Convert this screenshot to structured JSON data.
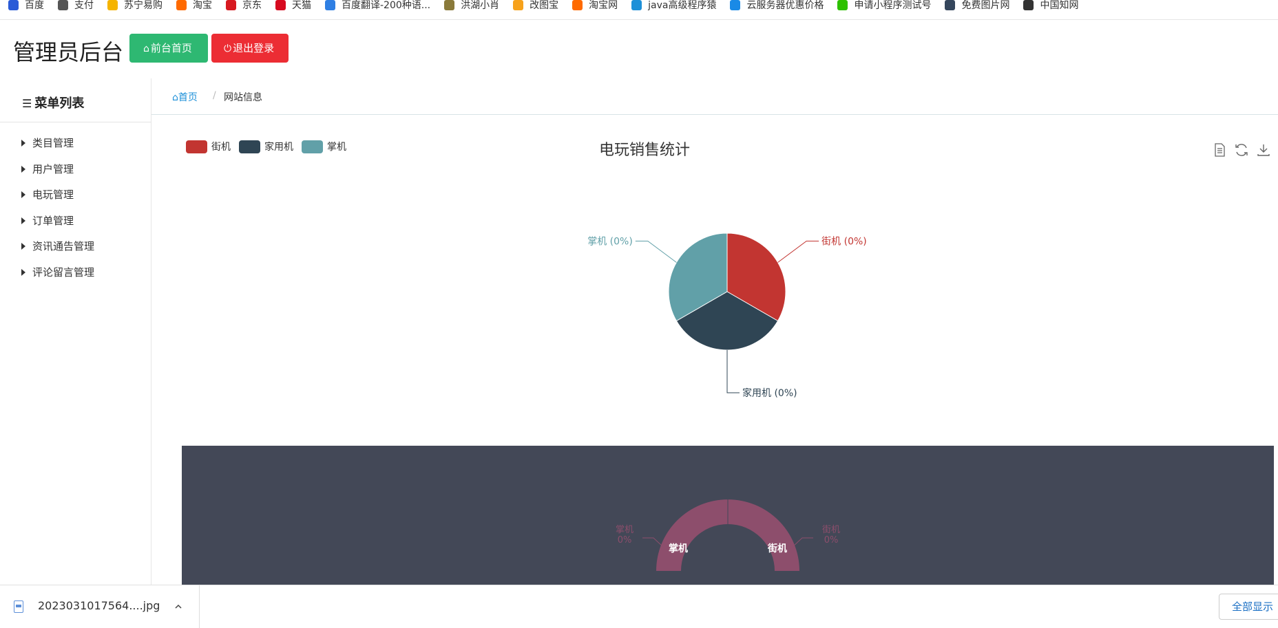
{
  "bookmarks": [
    {
      "label": "百度",
      "icon": "baidu-icon",
      "color": "#2a5bd7"
    },
    {
      "label": "支付",
      "icon": "globe-icon",
      "color": "#555555"
    },
    {
      "label": "苏宁易购",
      "icon": "suning-icon",
      "color": "#f5b400"
    },
    {
      "label": "淘宝",
      "icon": "taobao-icon",
      "color": "#ff6a00"
    },
    {
      "label": "京东",
      "icon": "jd-icon",
      "color": "#d71920"
    },
    {
      "label": "天猫",
      "icon": "tmall-icon",
      "color": "#d70a1f"
    },
    {
      "label": "百度翻译-200种语...",
      "icon": "translate-icon",
      "color": "#2f7fe3"
    },
    {
      "label": "洪湖小肖",
      "icon": "bird-icon",
      "color": "#8a7a3a"
    },
    {
      "label": "改图宝",
      "icon": "gaitubao-icon",
      "color": "#f7a21b"
    },
    {
      "label": "淘宝网",
      "icon": "taobao-net-icon",
      "color": "#ff6a00"
    },
    {
      "label": "java高级程序猿",
      "icon": "bilibili-icon",
      "color": "#1e90d8"
    },
    {
      "label": "云服务器优惠价格",
      "icon": "cloud-icon",
      "color": "#1a8ae6"
    },
    {
      "label": "申请小程序测试号",
      "icon": "wechat-icon",
      "color": "#2dc100"
    },
    {
      "label": "免费图片网",
      "icon": "tumblr-icon",
      "color": "#35465c"
    },
    {
      "label": "中国知网",
      "icon": "cnki-icon",
      "color": "#333333"
    }
  ],
  "header": {
    "title": "管理员后台",
    "home_button": "前台首页",
    "logout_button": "退出登录"
  },
  "sidebar": {
    "title": "菜单列表",
    "items": [
      "类目管理",
      "用户管理",
      "电玩管理",
      "订单管理",
      "资讯通告管理",
      "评论留言管理"
    ]
  },
  "breadcrumb": {
    "home": "首页",
    "current": "网站信息"
  },
  "colors": {
    "arcade": "#c23531",
    "console": "#2f4554",
    "handheld": "#61a0a8",
    "dark_bg": "#434857",
    "rose": "#8d4e6c"
  },
  "chart_data": [
    {
      "type": "pie",
      "title": "电玩销售统计",
      "legend": [
        "街机",
        "家用机",
        "掌机"
      ],
      "legend_position": "top-left",
      "slices": [
        {
          "name": "街机",
          "value": 1,
          "label": "街机 (0%)"
        },
        {
          "name": "家用机",
          "value": 1,
          "label": "家用机 (0%)"
        },
        {
          "name": "掌机",
          "value": 1,
          "label": "掌机 (0%)"
        }
      ]
    },
    {
      "type": "pie",
      "variant": "donut",
      "slices": [
        {
          "name": "街机",
          "percent_label": "0%"
        },
        {
          "name": "掌机",
          "percent_label": "0%"
        }
      ]
    }
  ],
  "downloads": {
    "file_name": "2023031017564....jpg",
    "show_all": "全部显示"
  }
}
